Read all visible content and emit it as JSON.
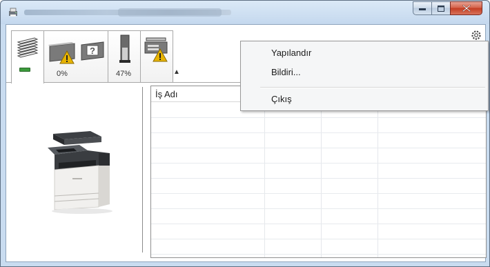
{
  "menu": {
    "items": [
      {
        "label": "Yapılandır"
      },
      {
        "label": "Bildiri..."
      },
      {
        "label": "Çıkış"
      }
    ]
  },
  "tabs": {
    "toner_percent": "0%",
    "paper_percent": "47%"
  },
  "grid": {
    "column_job_name": "İş Adı"
  },
  "colors": {
    "titlebar": "#c4d8ee",
    "close_button": "#c43d22",
    "warning": "#e8b400",
    "status_ok": "#3c9a3c"
  }
}
